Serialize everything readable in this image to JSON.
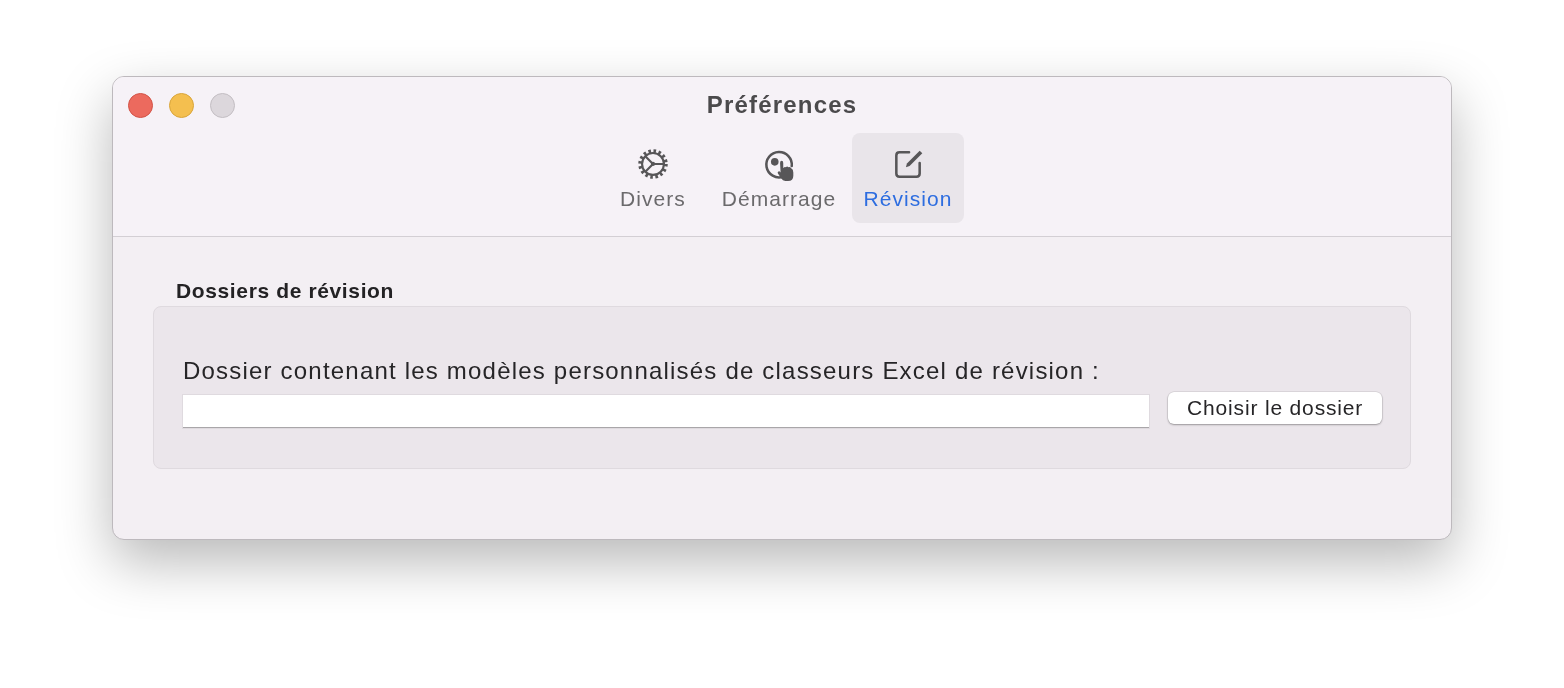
{
  "window": {
    "title": "Préférences",
    "controls": [
      {
        "kind": "close",
        "disabled": false
      },
      {
        "kind": "minimize",
        "disabled": false
      },
      {
        "kind": "zoom",
        "disabled": true
      }
    ]
  },
  "tabs": [
    {
      "label": "Divers",
      "kind": "gear",
      "selected": false
    },
    {
      "label": "Démarrage",
      "kind": "pointer",
      "selected": false
    },
    {
      "label": "Révision",
      "kind": "compose",
      "selected": true
    }
  ],
  "section": {
    "heading": "Dossiers de révision",
    "label": "Dossier contenant les modèles personnalisés de classeurs Excel de révision :",
    "button": "Choisir le dossier"
  }
}
